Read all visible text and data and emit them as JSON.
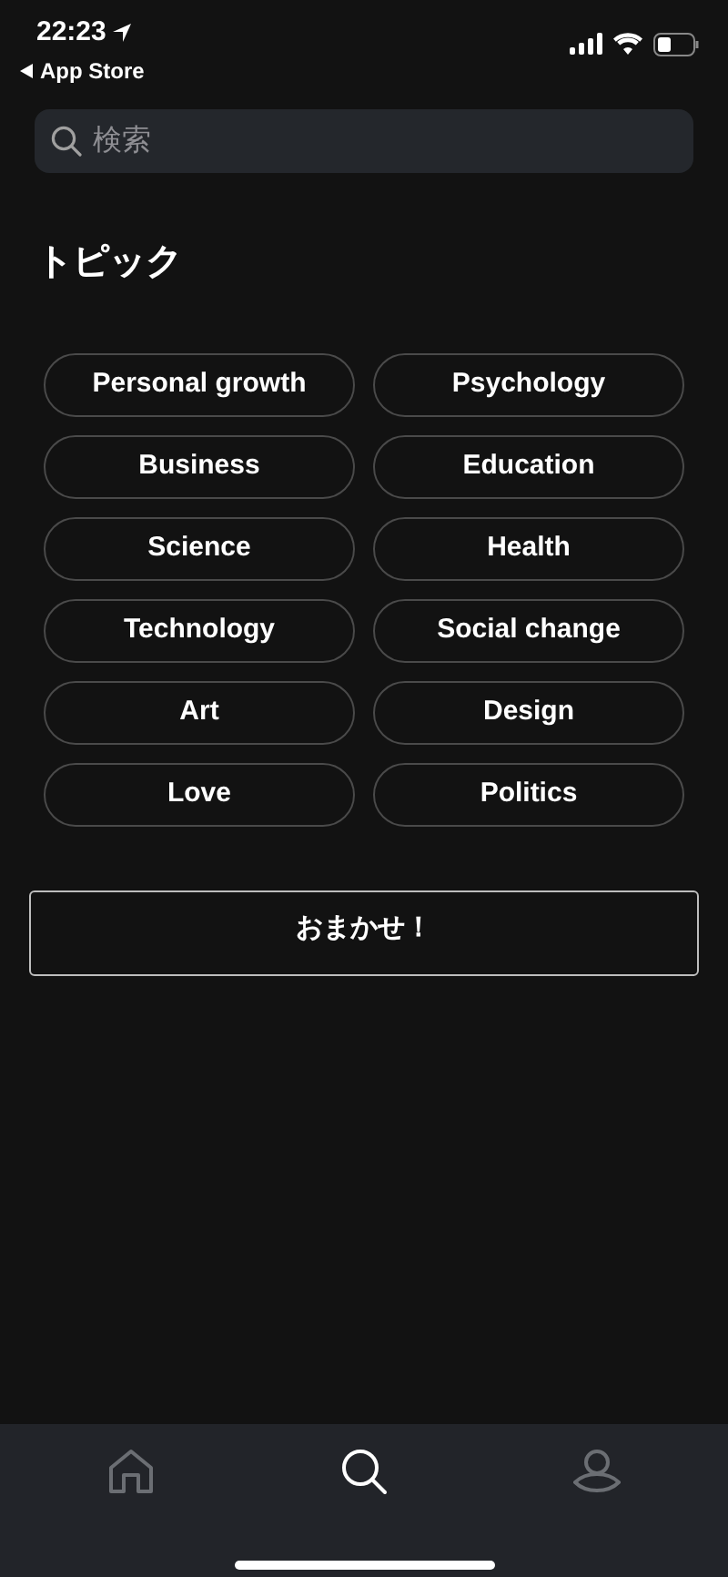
{
  "status_bar": {
    "time": "22:23",
    "back": "App Store"
  },
  "search": {
    "placeholder": "検索"
  },
  "section_title": "トピック",
  "topics": [
    "Personal growth",
    "Psychology",
    "Business",
    "Education",
    "Science",
    "Health",
    "Technology",
    "Social change",
    "Art",
    "Design",
    "Love",
    "Politics"
  ],
  "random_button": "おまかせ！",
  "tab_bar": [
    {
      "kind": "home",
      "selected": false
    },
    {
      "kind": "search",
      "selected": true
    },
    {
      "kind": "profile",
      "selected": false
    }
  ]
}
